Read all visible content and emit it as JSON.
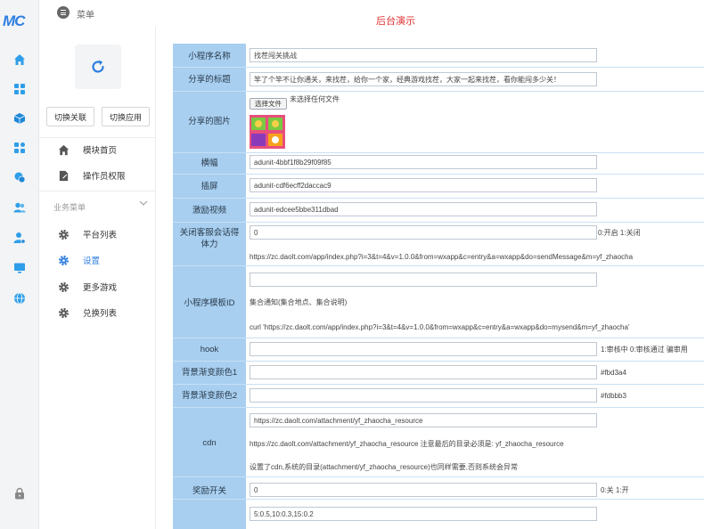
{
  "brand": {
    "logo_text": "MC",
    "accent": "#2f7fe0"
  },
  "topbar": {
    "menu_label": "菜单",
    "page_title": "后台演示",
    "title_color": "#e23030"
  },
  "rail": {
    "icons": [
      "home-icon",
      "grid-icon",
      "cube-icon",
      "apps-icon",
      "coins-icon",
      "users-icon",
      "user-settings-icon",
      "monitor-icon",
      "globe-icon",
      "lock-icon"
    ]
  },
  "sidebar": {
    "switch_link": "切换关联",
    "switch_app": "切换应用",
    "items_top": [
      {
        "label": "模块首页",
        "icon": "home-icon"
      },
      {
        "label": "操作员权限",
        "icon": "edit-doc-icon"
      }
    ],
    "group_title": "业务菜单",
    "items_group": [
      {
        "label": "平台列表",
        "icon": "gear-icon",
        "active": false
      },
      {
        "label": "设置",
        "icon": "gear-icon",
        "active": true
      },
      {
        "label": "更多游戏",
        "icon": "gear-icon",
        "active": false
      },
      {
        "label": "兑换列表",
        "icon": "gear-icon",
        "active": false
      }
    ]
  },
  "form": {
    "name": {
      "label": "小程序名称",
      "value": "找茬闯关挑战"
    },
    "share_title": {
      "label": "分享的标题",
      "value": "竿了个竿不让你通关，来找茬，给你一个家，经典游戏找茬，大家一起来找茬，看你能闯多少关！"
    },
    "share_image": {
      "label": "分享的图片",
      "button": "选择文件",
      "status": "未选择任何文件"
    },
    "banner": {
      "label": "横幅",
      "value": "adunit-4bbf1f8b29f09f85"
    },
    "interstitial": {
      "label": "插屏",
      "value": "adunit-cdf6ecff2daccac9"
    },
    "reward_video": {
      "label": "激励视频",
      "value": "adunit-edcee5bbe311dbad"
    },
    "close_cs": {
      "label": "关闭客服会话得体力",
      "value": "0",
      "hint": "0:开启 1:关闭",
      "url": "https://zc.daolt.com/app/index.php?i=3&t=4&v=1.0.0&from=wxapp&c=entry&a=wxapp&do=sendMessage&m=yf_zhaocha"
    },
    "template_id": {
      "label": "小程序模板ID",
      "value": "",
      "note": "集合通知(集合地点、集合说明)",
      "curl": "curl 'https://zc.daolt.com/app/index.php?i=3&t=4&v=1.0.0&from=wxapp&c=entry&a=wxapp&do=mysend&m=yf_zhaocha'"
    },
    "hook": {
      "label": "hook",
      "value": "",
      "hint": "1:审核中 0:审核通过 骗审用"
    },
    "bg_color1": {
      "label": "背景渐变颜色1",
      "value": "",
      "hint": "#fbd3a4"
    },
    "bg_color2": {
      "label": "背景渐变颜色2",
      "value": "",
      "hint": "#fdbbb3"
    },
    "cdn": {
      "label": "cdn",
      "value": "https://zc.daolt.com/attachment/yf_zhaocha_resource",
      "note1": "https://zc.daolt.com/attachment/yf_zhaocha_resource 注意最后的目录必须是: yf_zhaocha_resource",
      "note2": "设置了cdn,系统的目录(attachment/yf_zhaocha_resource)也同样需要,否则系统会异常"
    },
    "reward_switch": {
      "label": "奖励开关",
      "value": "0",
      "hint": "0:关 1:开"
    },
    "reward_ratio": {
      "value": "5:0.5,10:0.3,15:0.2"
    }
  }
}
